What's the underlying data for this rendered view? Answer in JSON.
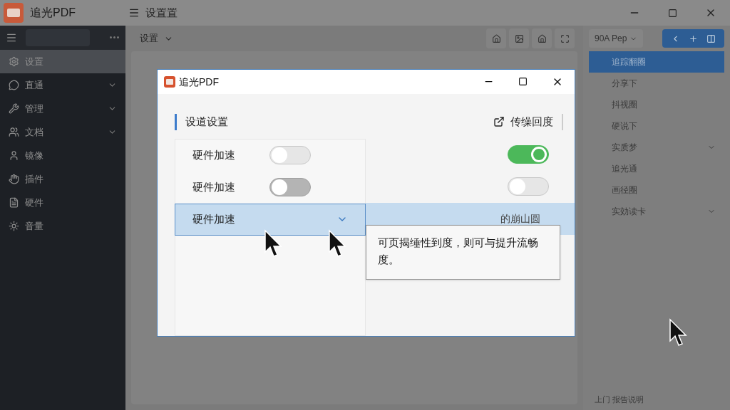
{
  "app": {
    "title": "追光PDF",
    "header": "设置置"
  },
  "sidebar": {
    "items": [
      {
        "label": "设置",
        "selected": true,
        "expandable": false
      },
      {
        "label": "直通",
        "selected": false,
        "expandable": true
      },
      {
        "label": "管理",
        "selected": false,
        "expandable": true
      },
      {
        "label": "文档",
        "selected": false,
        "expandable": true
      },
      {
        "label": "镜像",
        "selected": false,
        "expandable": false
      },
      {
        "label": "插件",
        "selected": false,
        "expandable": false
      },
      {
        "label": "硬件",
        "selected": false,
        "expandable": false
      },
      {
        "label": "音量",
        "selected": false,
        "expandable": false
      }
    ]
  },
  "toolbar": {
    "dropdown": "设置"
  },
  "right_panel": {
    "dropdown": "90A Pep",
    "items": [
      {
        "label": "追踪翻圈",
        "selected": true,
        "expandable": false
      },
      {
        "label": "分享下",
        "selected": false,
        "expandable": false
      },
      {
        "label": "抖视圈",
        "selected": false,
        "expandable": false
      },
      {
        "label": "硬说下",
        "selected": false,
        "expandable": false
      },
      {
        "label": "实质梦",
        "selected": false,
        "expandable": true
      },
      {
        "label": "追光通",
        "selected": false,
        "expandable": false
      },
      {
        "label": "画径圈",
        "selected": false,
        "expandable": false
      },
      {
        "label": "实効读卡",
        "selected": false,
        "expandable": true
      }
    ],
    "footer": "上门 报告说明"
  },
  "dialog": {
    "title": "追光PDF",
    "section": "设道设置",
    "action": "传缲回度",
    "rows": [
      {
        "label": "硬件加速",
        "kind": "toggle",
        "on": false,
        "selected": false
      },
      {
        "label": "硬件加速",
        "kind": "toggle",
        "on": false,
        "selected": false
      },
      {
        "label": "硬件加速",
        "kind": "dropdown",
        "selected": true
      }
    ],
    "right_switches": [
      {
        "on": true
      },
      {
        "on": false
      }
    ],
    "partial_text": "的崩山圆",
    "tooltip": "可页揭缍性到度，则可与提升流畅度。"
  }
}
